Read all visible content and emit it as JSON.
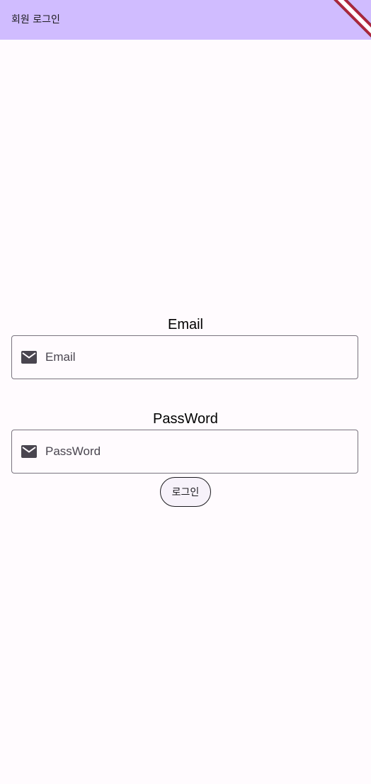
{
  "app_bar": {
    "title": "회원 로그인"
  },
  "form": {
    "email": {
      "label": "Email",
      "placeholder": "Email",
      "icon": "mail-icon"
    },
    "password": {
      "label": "PassWord",
      "placeholder": "PassWord",
      "icon": "mail-icon"
    },
    "submit_label": "로그인"
  },
  "colors": {
    "app_bar": "#d0bcff",
    "background": "#fffbfe",
    "border": "#79747e",
    "icon": "#49454f",
    "debug_banner": "#b0263e"
  }
}
